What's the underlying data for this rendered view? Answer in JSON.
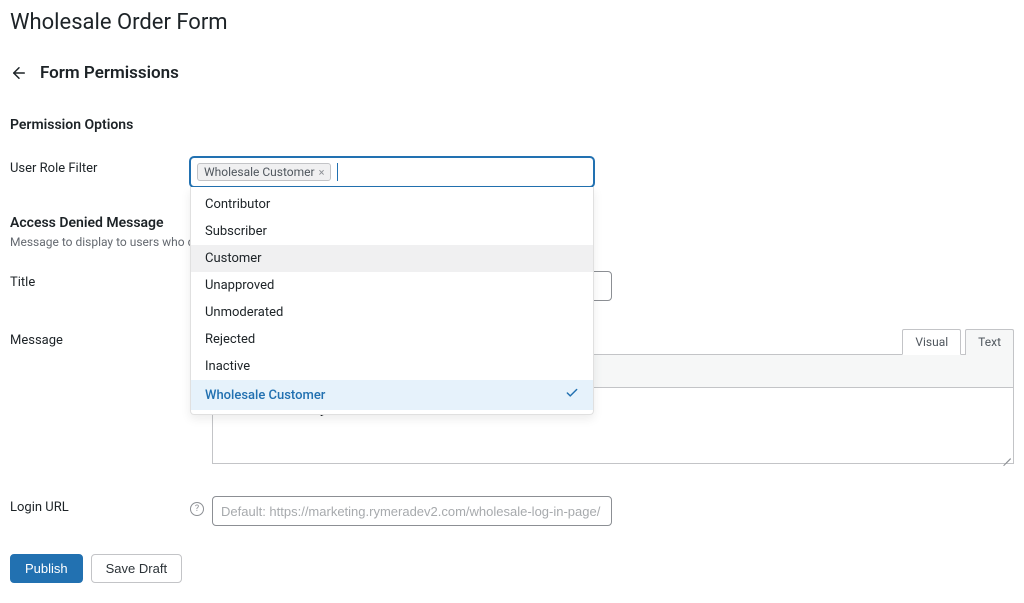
{
  "page_title": "Wholesale Order Form",
  "subheader_title": "Form Permissions",
  "section_permission_options": "Permission Options",
  "user_role_filter": {
    "label": "User Role Filter",
    "selected_tag": "Wholesale Customer",
    "options": [
      {
        "label": "Contributor",
        "selected": false,
        "highlight": false
      },
      {
        "label": "Subscriber",
        "selected": false,
        "highlight": false
      },
      {
        "label": "Customer",
        "selected": false,
        "highlight": true
      },
      {
        "label": "Unapproved",
        "selected": false,
        "highlight": false
      },
      {
        "label": "Unmoderated",
        "selected": false,
        "highlight": false
      },
      {
        "label": "Rejected",
        "selected": false,
        "highlight": false
      },
      {
        "label": "Inactive",
        "selected": false,
        "highlight": false
      },
      {
        "label": "Wholesale Customer",
        "selected": true,
        "highlight": false
      }
    ]
  },
  "access_denied": {
    "heading": "Access Denied Message",
    "subtext": "Message to display to users who do no"
  },
  "title_field": {
    "label": "Title",
    "value": ""
  },
  "message_field": {
    "label": "Message",
    "tabs": {
      "visual": "Visual",
      "text": "Text",
      "active": "visual"
    },
    "body": "You do not have permission to view this order form."
  },
  "login_url": {
    "label": "Login URL",
    "placeholder": "Default: https://marketing.rymeradev2.com/wholesale-log-in-page/",
    "value": ""
  },
  "buttons": {
    "publish": "Publish",
    "save_draft": "Save Draft"
  }
}
